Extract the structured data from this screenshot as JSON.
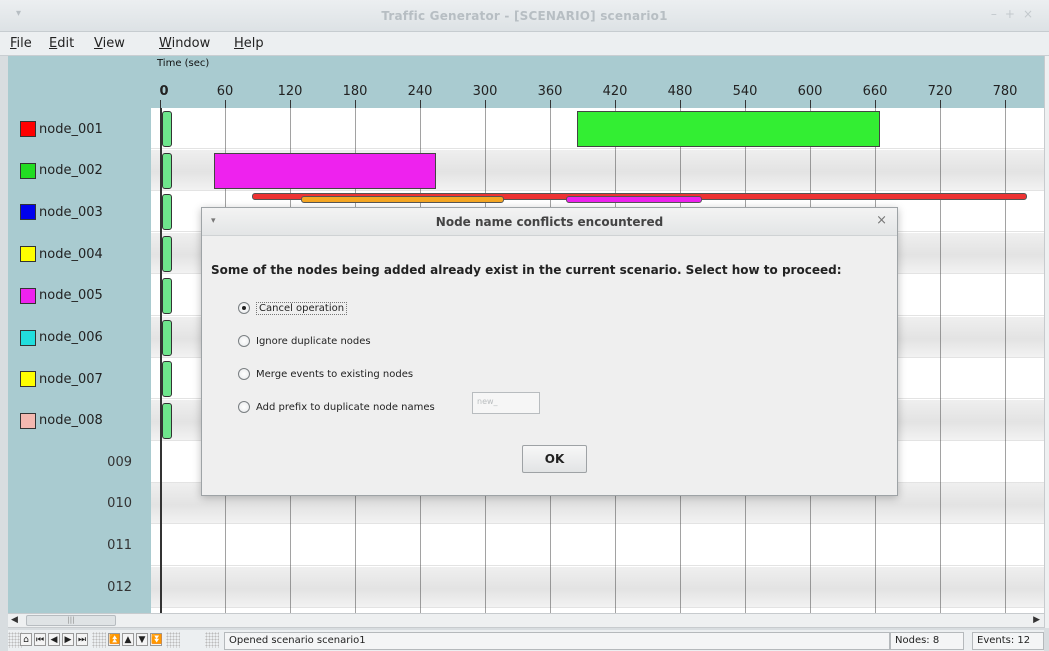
{
  "window": {
    "title": "Traffic Generator - [SCENARIO] scenario1"
  },
  "menubar": {
    "items": [
      {
        "label": "File",
        "mnemonic": "F",
        "rest": "ile"
      },
      {
        "label": "Edit",
        "mnemonic": "E",
        "rest": "dit"
      },
      {
        "label": "View",
        "mnemonic": "V",
        "rest": "iew"
      },
      {
        "label": "Window",
        "mnemonic": "W",
        "rest": "indow"
      },
      {
        "label": "Help",
        "mnemonic": "H",
        "rest": "elp"
      }
    ]
  },
  "timeline": {
    "axis_label": "Time (sec)",
    "ticks": [
      "0",
      "60",
      "120",
      "180",
      "240",
      "300",
      "360",
      "420",
      "480",
      "540",
      "600",
      "660",
      "720",
      "780"
    ],
    "nodes": [
      {
        "name": "node_001",
        "color": "#ff0000"
      },
      {
        "name": "node_002",
        "color": "#22dd22"
      },
      {
        "name": "node_003",
        "color": "#0000ee"
      },
      {
        "name": "node_004",
        "color": "#ffff00"
      },
      {
        "name": "node_005",
        "color": "#ee22ee"
      },
      {
        "name": "node_006",
        "color": "#22dddd"
      },
      {
        "name": "node_007",
        "color": "#ffff00"
      },
      {
        "name": "node_008",
        "color": "#f4b8b0"
      }
    ],
    "empty_rows": [
      "009",
      "010",
      "011",
      "012"
    ],
    "events": [
      {
        "row": 0,
        "start": 385,
        "end": 665,
        "color": "#33ee33"
      },
      {
        "row": 1,
        "start": 50,
        "end": 255,
        "color": "#ee22ee"
      }
    ],
    "thin_events": [
      {
        "row": 2,
        "start": 85,
        "end": 800,
        "color": "#ee3333"
      },
      {
        "row": 2,
        "start": 130,
        "end": 318,
        "color": "#f5a623"
      },
      {
        "row": 2,
        "start": 375,
        "end": 500,
        "color": "#ee22ee"
      }
    ],
    "start_marker_color": "#6ee68c"
  },
  "dialog": {
    "title": "Node name conflicts encountered",
    "message": "Some of the nodes being added already exist in the current scenario.  Select how to proceed:",
    "options": [
      {
        "label": "Cancel operation",
        "selected": true
      },
      {
        "label": "Ignore duplicate nodes",
        "selected": false
      },
      {
        "label": "Merge events to existing nodes",
        "selected": false
      },
      {
        "label": "Add prefix to duplicate node names",
        "selected": false
      }
    ],
    "prefix_value": "new_",
    "ok_label": "OK"
  },
  "statusbar": {
    "message": "Opened scenario scenario1",
    "nodes": "Nodes: 8",
    "events": "Events: 12"
  },
  "icons": {
    "nav": [
      "home-icon",
      "first-icon",
      "prev-icon",
      "next-icon",
      "last-icon",
      "top-icon",
      "up-icon",
      "down-icon",
      "bottom-icon"
    ]
  }
}
